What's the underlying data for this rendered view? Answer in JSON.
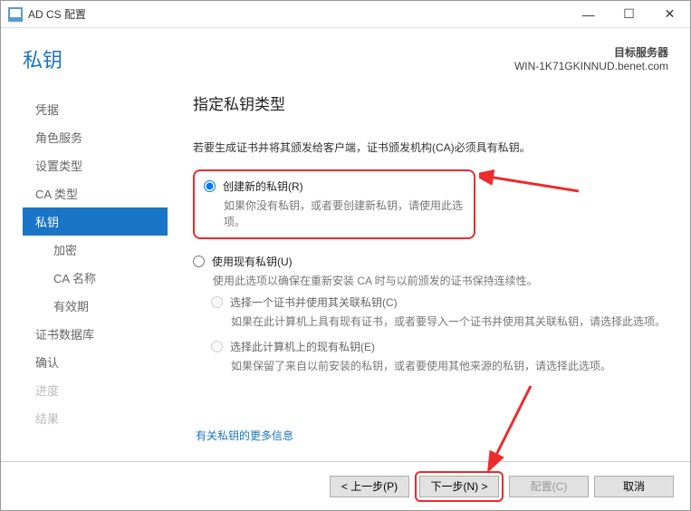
{
  "window": {
    "title": "AD CS 配置",
    "minimize": "—",
    "maximize": "☐",
    "close": "✕"
  },
  "page": {
    "title": "私钥",
    "target_label": "目标服务器",
    "target_server": "WIN-1K71GKINNUD.benet.com"
  },
  "nav": {
    "items": [
      "凭据",
      "角色服务",
      "设置类型",
      "CA 类型",
      "私钥",
      "加密",
      "CA 名称",
      "有效期",
      "证书数据库",
      "确认",
      "进度",
      "结果"
    ]
  },
  "main": {
    "heading": "指定私钥类型",
    "intro": "若要生成证书并将其颁发给客户端，证书颁发机构(CA)必须具有私钥。",
    "opt1_label": "创建新的私钥(R)",
    "opt1_desc": "如果你没有私钥，或者要创建新私钥，请使用此选项。",
    "opt2_label": "使用现有私钥(U)",
    "opt2_desc": "使用此选项以确保在重新安装 CA 时与以前颁发的证书保持连续性。",
    "opt2a_label": "选择一个证书并使用其关联私钥(C)",
    "opt2a_desc": "如果在此计算机上具有现有证书，或者要导入一个证书并使用其关联私钥，请选择此选项。",
    "opt2b_label": "选择此计算机上的现有私钥(E)",
    "opt2b_desc": "如果保留了来自以前安装的私钥，或者要使用其他来源的私钥，请选择此选项。",
    "more_link": "有关私钥的更多信息"
  },
  "footer": {
    "prev": "< 上一步(P)",
    "next": "下一步(N) >",
    "configure": "配置(C)",
    "cancel": "取消"
  }
}
